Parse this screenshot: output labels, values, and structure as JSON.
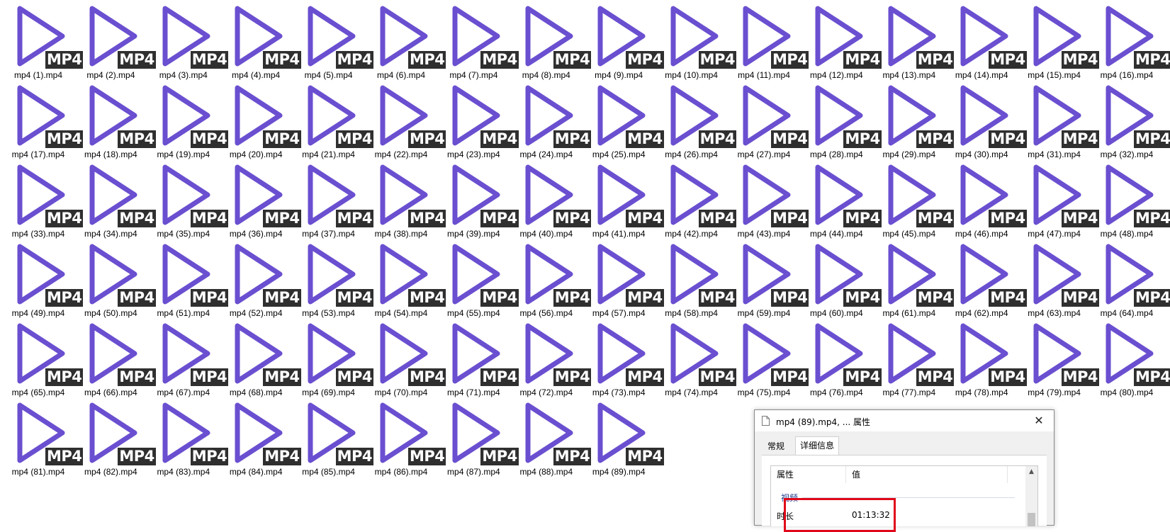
{
  "badge_text": "MP4",
  "accent_color": "#6a4fd0",
  "badge_color": "#2f2f2f",
  "files": [
    "mp4 (1).mp4",
    "mp4 (2).mp4",
    "mp4 (3).mp4",
    "mp4 (4).mp4",
    "mp4 (5).mp4",
    "mp4 (6).mp4",
    "mp4 (7).mp4",
    "mp4 (8).mp4",
    "mp4 (9).mp4",
    "mp4 (10).mp4",
    "mp4 (11).mp4",
    "mp4 (12).mp4",
    "mp4 (13).mp4",
    "mp4 (14).mp4",
    "mp4 (15).mp4",
    "mp4 (16).mp4",
    "mp4 (17).mp4",
    "mp4 (18).mp4",
    "mp4 (19).mp4",
    "mp4 (20).mp4",
    "mp4 (21).mp4",
    "mp4 (22).mp4",
    "mp4 (23).mp4",
    "mp4 (24).mp4",
    "mp4 (25).mp4",
    "mp4 (26).mp4",
    "mp4 (27).mp4",
    "mp4 (28).mp4",
    "mp4 (29).mp4",
    "mp4 (30).mp4",
    "mp4 (31).mp4",
    "mp4 (32).mp4",
    "mp4 (33).mp4",
    "mp4 (34).mp4",
    "mp4 (35).mp4",
    "mp4 (36).mp4",
    "mp4 (37).mp4",
    "mp4 (38).mp4",
    "mp4 (39).mp4",
    "mp4 (40).mp4",
    "mp4 (41).mp4",
    "mp4 (42).mp4",
    "mp4 (43).mp4",
    "mp4 (44).mp4",
    "mp4 (45).mp4",
    "mp4 (46).mp4",
    "mp4 (47).mp4",
    "mp4 (48).mp4",
    "mp4 (49).mp4",
    "mp4 (50).mp4",
    "mp4 (51).mp4",
    "mp4 (52).mp4",
    "mp4 (53).mp4",
    "mp4 (54).mp4",
    "mp4 (55).mp4",
    "mp4 (56).mp4",
    "mp4 (57).mp4",
    "mp4 (58).mp4",
    "mp4 (59).mp4",
    "mp4 (60).mp4",
    "mp4 (61).mp4",
    "mp4 (62).mp4",
    "mp4 (63).mp4",
    "mp4 (64).mp4",
    "mp4 (65).mp4",
    "mp4 (66).mp4",
    "mp4 (67).mp4",
    "mp4 (68).mp4",
    "mp4 (69).mp4",
    "mp4 (70).mp4",
    "mp4 (71).mp4",
    "mp4 (72).mp4",
    "mp4 (73).mp4",
    "mp4 (74).mp4",
    "mp4 (75).mp4",
    "mp4 (76).mp4",
    "mp4 (77).mp4",
    "mp4 (78).mp4",
    "mp4 (79).mp4",
    "mp4 (80).mp4",
    "mp4 (81).mp4",
    "mp4 (82).mp4",
    "mp4 (83).mp4",
    "mp4 (84).mp4",
    "mp4 (85).mp4",
    "mp4 (86).mp4",
    "mp4 (87).mp4",
    "mp4 (88).mp4",
    "mp4 (89).mp4"
  ],
  "dialog": {
    "title": "mp4 (89).mp4, ... 属性",
    "close": "✕",
    "tabs": {
      "general": "常规",
      "details": "详细信息"
    },
    "columns": {
      "property": "属性",
      "value": "值"
    },
    "group": "视频",
    "row": {
      "name": "时长",
      "value": "01:13:32"
    },
    "highlight_color": "#e0081a"
  }
}
